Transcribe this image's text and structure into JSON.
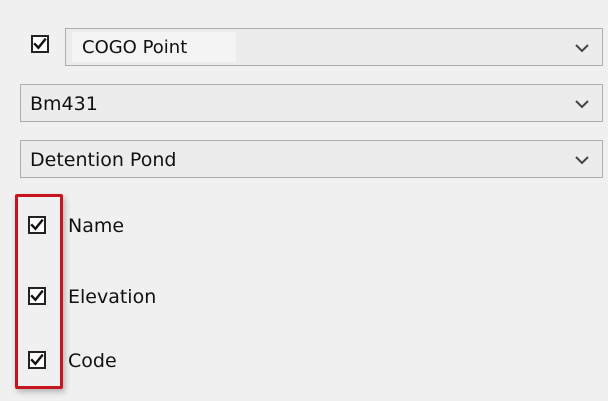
{
  "header": {
    "enabled": true,
    "object_type": "COGO Point"
  },
  "dropdowns": [
    {
      "value": "Bm431"
    },
    {
      "value": "Detention Pond"
    }
  ],
  "options": [
    {
      "label": "Name",
      "checked": true
    },
    {
      "label": "Elevation",
      "checked": true
    },
    {
      "label": "Code",
      "checked": true
    }
  ],
  "colors": {
    "highlight": "#c8141e",
    "background": "#f0f0f0"
  },
  "icons": {
    "check": "checkmark-icon",
    "dropdown": "chevron-down-icon"
  }
}
